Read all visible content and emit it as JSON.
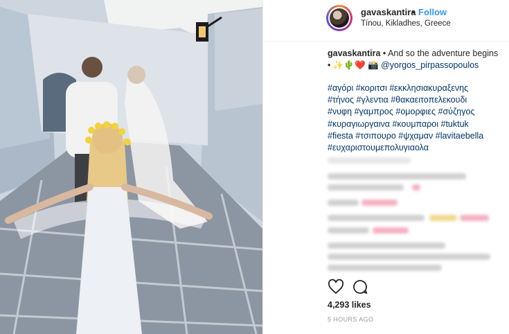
{
  "post": {
    "username": "gavaskantira",
    "separator": "•",
    "follow_label": "Follow",
    "location": "Tínou, Kikladhes, Greece"
  },
  "caption": {
    "username": "gavaskantira",
    "text": "• And so the adventure begins",
    "emoji_line": "• ✨🌵❤️ 📸 ",
    "mention": "@yorgos_pirpassopoulos"
  },
  "hashtags": {
    "line1": "#αγόρι #κοριτσι #εκκλησιακυραξενης",
    "line2": "#τήνος #γλεντια #θακαειτοπελεκουδι",
    "line3": "#νυφη #γαμπρος #ομορφιες #σύζηγος",
    "line4": "#κυραγιωργαινα #κουμπαροι #tuktuk",
    "line5": "#fiesta #τσιπουρο #ψχαμαν #lavitaebella",
    "line6": "#ευχαριστουμεπολυγιαολα"
  },
  "actions": {
    "like_icon": "heart-outline-icon",
    "comment_icon": "comment-bubble-icon"
  },
  "likes": "4,293 likes",
  "timestamp": "5 HOURS AGO",
  "colors": {
    "link": "#3897f0",
    "hashtag": "#003569",
    "text": "#262626",
    "muted": "#999999"
  }
}
